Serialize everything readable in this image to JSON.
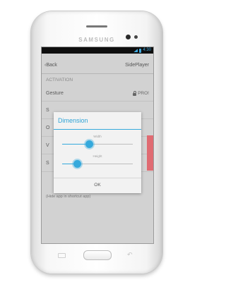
{
  "device": {
    "brand": "SAMSUNG"
  },
  "status_bar": {
    "time": "4:30"
  },
  "action_bar": {
    "back_label": "‹Back",
    "title": "SidePlayer"
  },
  "settings": {
    "section_header": "ACTIVATION",
    "rows": [
      {
        "label": "Gesture",
        "badge": "PRO!"
      },
      {
        "label": "S"
      },
      {
        "label": "O"
      },
      {
        "label": "V"
      },
      {
        "label": "S"
      }
    ],
    "hint_text": "(Hide app in shortcut app)"
  },
  "dialog": {
    "title": "Dimension",
    "sliders": [
      {
        "caption": "Width",
        "value_fraction": 0.38
      },
      {
        "caption": "Height",
        "value_fraction": 0.21
      }
    ],
    "ok_label": "OK"
  },
  "colors": {
    "accent": "#35a9dc",
    "handle": "#e06b72"
  },
  "icons": {
    "lock": "lock-icon",
    "signal": "signal-icon",
    "battery": "battery-icon"
  }
}
